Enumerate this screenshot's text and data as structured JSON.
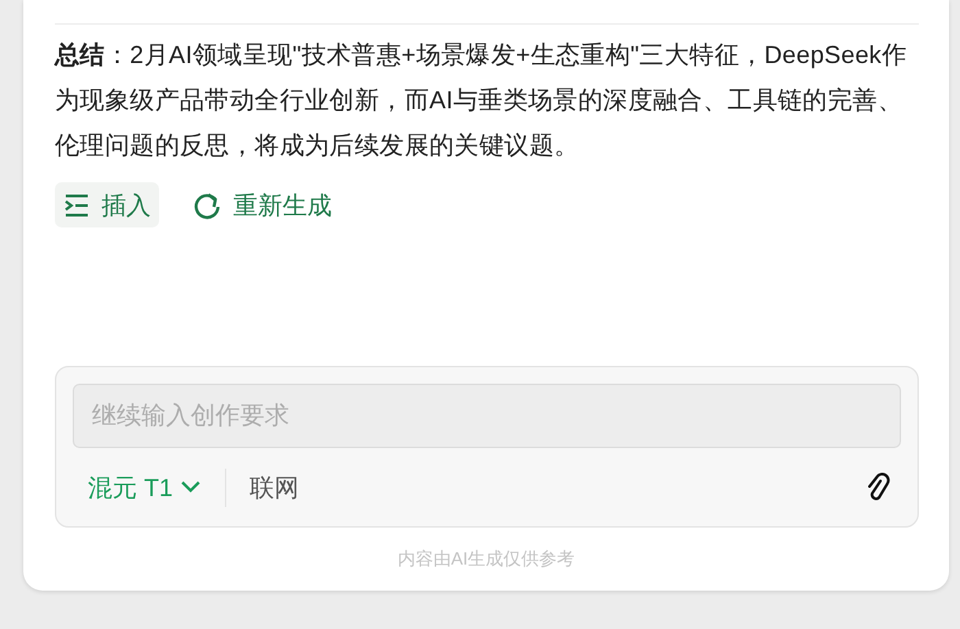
{
  "summary": {
    "text": "**总结**：2月AI领域呈现\"技术普惠+场景爆发+生态重构\"三大特征，DeepSeek作为现象级产品带动全行业创新，而AI与垂类场景的深度融合、工具链的完善、伦理问题的反思，将成为后续发展的关键议题。"
  },
  "actions": [
    {
      "kind": "insert",
      "label": "插入",
      "highlighted": true
    },
    {
      "kind": "regenerate",
      "label": "重新生成",
      "highlighted": false
    }
  ],
  "composer": {
    "placeholder": "继续输入创作要求",
    "model": "混元 T1",
    "web_search": {
      "label": "联网",
      "on": false
    }
  },
  "disclaimer": "内容由AI生成仅供参考"
}
